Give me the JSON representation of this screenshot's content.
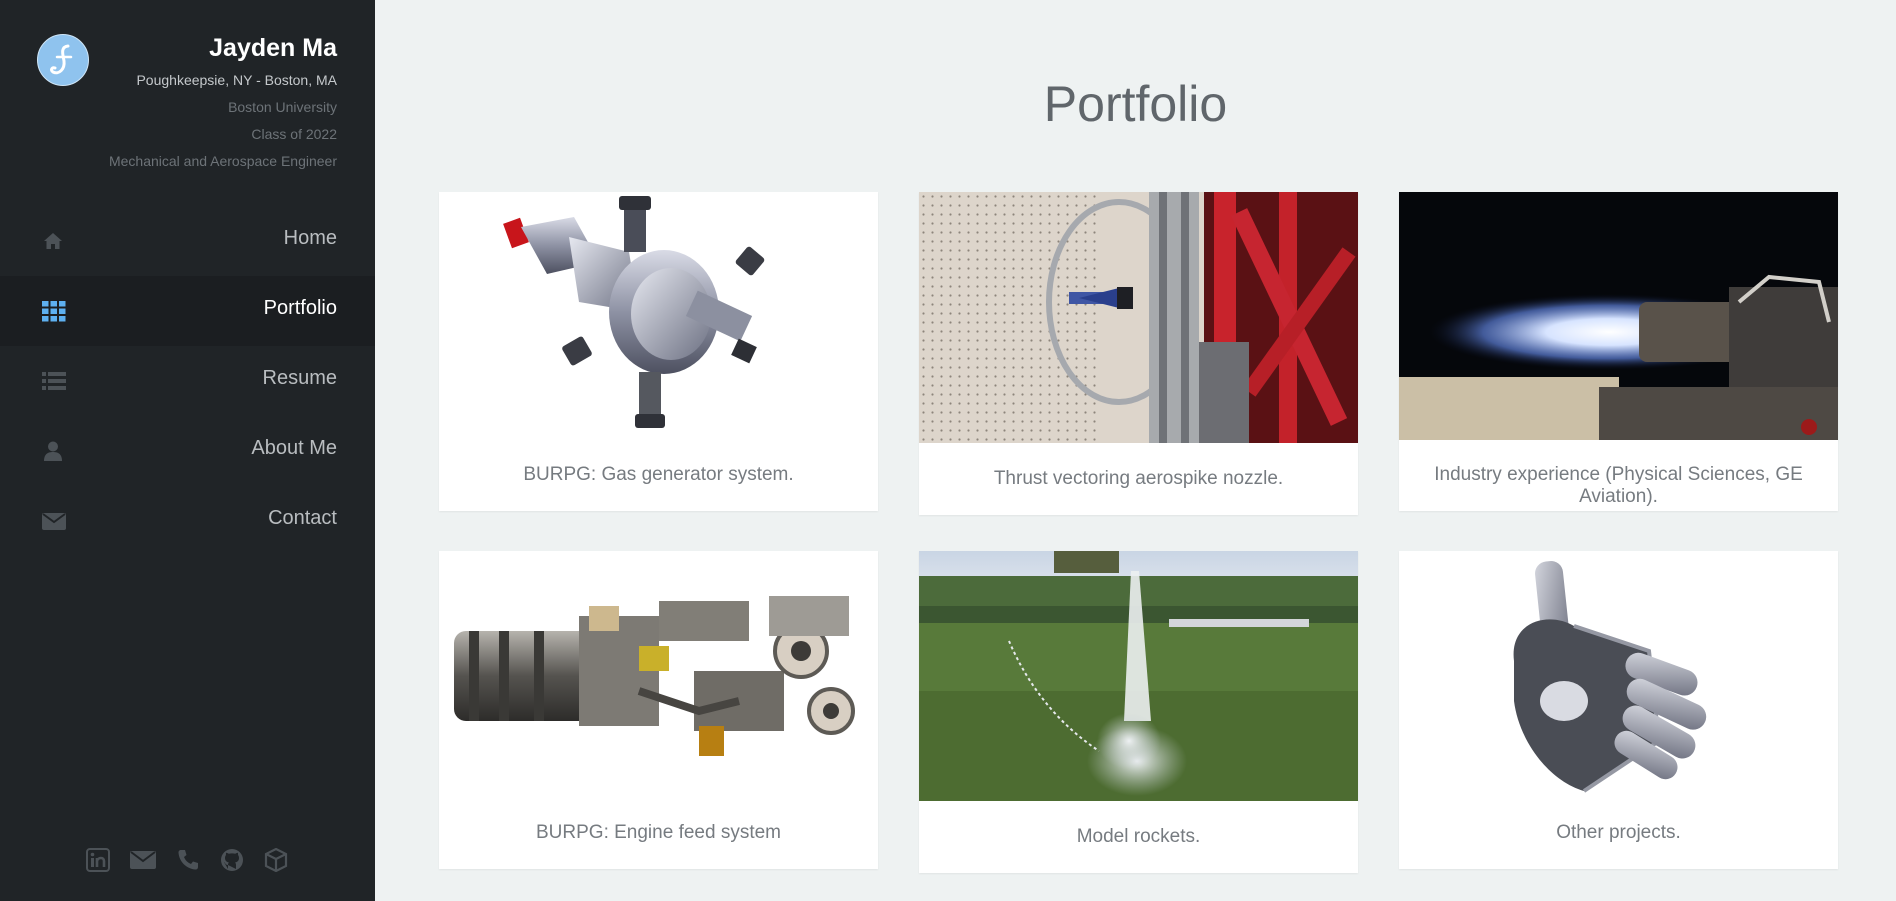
{
  "profile": {
    "name": "Jayden Ma",
    "location": "Poughkeepsie, NY - Boston, MA",
    "school": "Boston University",
    "class_year": "Class of 2022",
    "major": "Mechanical and Aerospace Engineer"
  },
  "nav": [
    {
      "label": "Home",
      "icon": "home-icon",
      "active": false
    },
    {
      "label": "Portfolio",
      "icon": "grid-icon",
      "active": true
    },
    {
      "label": "Resume",
      "icon": "list-icon",
      "active": false
    },
    {
      "label": "About Me",
      "icon": "user-icon",
      "active": false
    },
    {
      "label": "Contact",
      "icon": "envelope-icon",
      "active": false
    }
  ],
  "social_icons": [
    "linkedin-icon",
    "email-icon",
    "phone-icon",
    "github-icon",
    "cube-icon"
  ],
  "page_title": "Portfolio",
  "cards": [
    {
      "caption": "BURPG: Gas generator system.",
      "image": "gas-generator-render"
    },
    {
      "caption": "Thrust vectoring aerospike nozzle.",
      "image": "aerospike-nozzle-photo"
    },
    {
      "caption": "Industry experience (Physical Sciences, GE Aviation).",
      "image": "engine-exhaust-photo"
    },
    {
      "caption": "BURPG: Engine feed system",
      "image": "engine-feed-render"
    },
    {
      "caption": "Model rockets.",
      "image": "model-rocket-photo"
    },
    {
      "caption": "Other projects.",
      "image": "robotic-hand-render"
    }
  ],
  "colors": {
    "sidebar_bg": "#202427",
    "active_bg": "#1b1e21",
    "accent": "#5eb0f0",
    "page_bg": "#eef2f2"
  }
}
